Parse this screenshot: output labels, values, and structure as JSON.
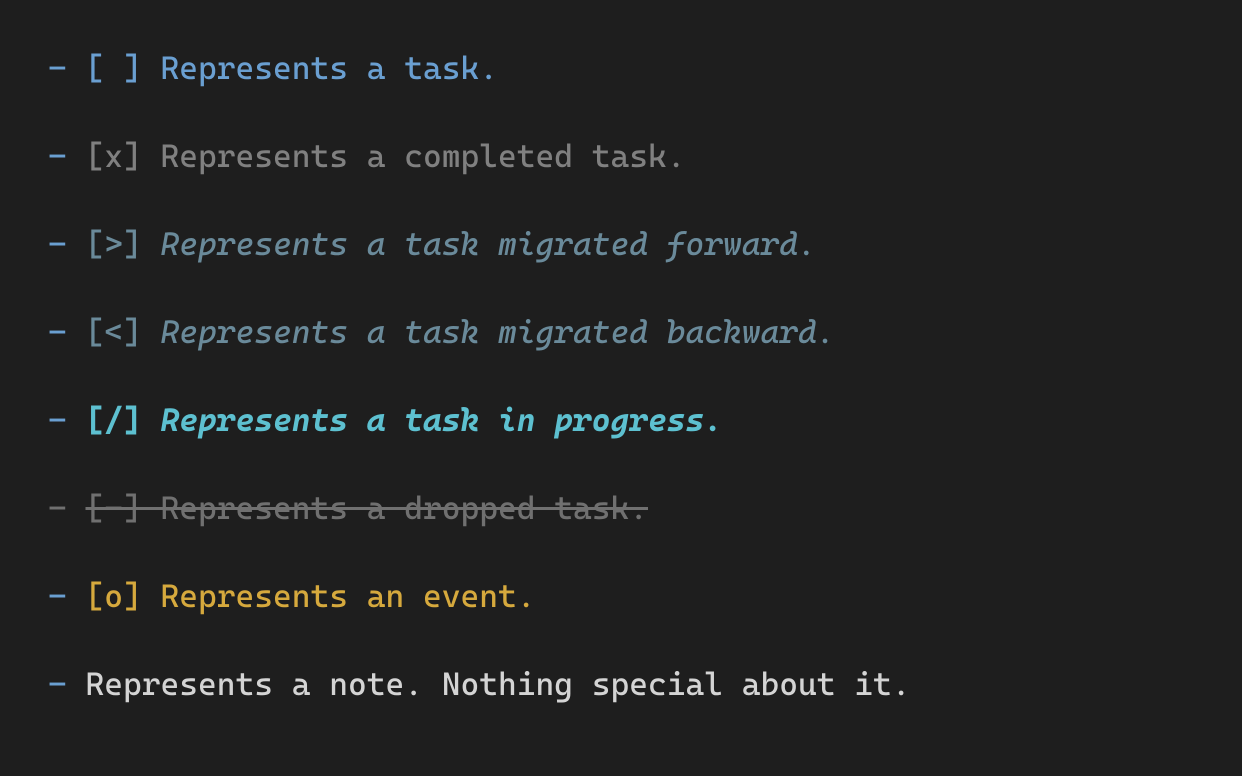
{
  "lines": [
    {
      "dash": "- ",
      "bracket": "[ ] ",
      "text": "Represents a task.",
      "style": "task",
      "name": "line-task"
    },
    {
      "dash": "- ",
      "bracket": "[x] ",
      "text": "Represents a completed task.",
      "style": "completed",
      "name": "line-completed"
    },
    {
      "dash": "- ",
      "bracket": "[>] ",
      "text": "Represents a task migrated forward.",
      "style": "migrated",
      "name": "line-migrated-forward"
    },
    {
      "dash": "- ",
      "bracket": "[<] ",
      "text": "Represents a task migrated backward.",
      "style": "migrated",
      "name": "line-migrated-backward"
    },
    {
      "dash": "- ",
      "bracket": "[/] ",
      "text": "Represents a task in progress.",
      "style": "progress",
      "name": "line-in-progress"
    },
    {
      "dash": "- ",
      "bracket": "[-] ",
      "text": "Represents a dropped task.",
      "style": "dropped",
      "name": "line-dropped"
    },
    {
      "dash": "- ",
      "bracket": "[o] ",
      "text": "Represents an event.",
      "style": "event",
      "name": "line-event"
    },
    {
      "dash": "- ",
      "bracket": "",
      "text": "Represents a note. Nothing special about it.",
      "style": "note",
      "name": "line-note"
    }
  ]
}
